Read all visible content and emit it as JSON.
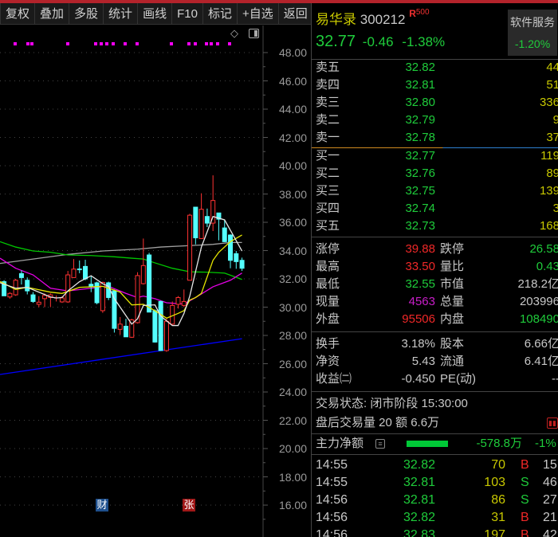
{
  "toolbar": {
    "buttons": [
      "复权",
      "叠加",
      "多股",
      "统计",
      "画线",
      "F10",
      "标记",
      "+自选",
      "返回"
    ]
  },
  "chart_data": {
    "type": "candlestick",
    "y_ticks": [
      "48.00",
      "46.00",
      "44.00",
      "42.00",
      "40.00",
      "38.00",
      "36.00",
      "34.00",
      "32.00",
      "30.00",
      "28.00",
      "26.00",
      "24.00",
      "22.00",
      "20.00",
      "18.00",
      "16.00"
    ],
    "ylim": [
      16,
      48
    ],
    "grid": true,
    "colors": {
      "up": "#ff3232",
      "down": "#54ffff",
      "ma5": "#e6e6e6",
      "ma10": "#e6e600",
      "ma20": "#e600e6",
      "ma60": "#00c800",
      "ma_long": "#a0a0a0",
      "trend": "#0000ff",
      "event_dot": "#ff00ff"
    },
    "candles": [
      [
        31.8,
        30.8,
        31.9,
        30.8
      ],
      [
        30.72,
        30.97,
        31.06,
        30.6
      ],
      [
        30.87,
        31.9,
        32.0,
        30.8
      ],
      [
        32.37,
        32.09,
        32.6,
        31.6
      ],
      [
        31.9,
        31.15,
        32.1,
        30.9
      ],
      [
        30.87,
        30.4,
        31.06,
        30.3
      ],
      [
        30.2,
        30.35,
        30.78,
        30.0
      ],
      [
        30.6,
        30.83,
        30.97,
        30.0
      ],
      [
        30.68,
        30.87,
        30.97,
        30.0
      ],
      [
        30.65,
        30.65,
        30.83,
        30.4
      ],
      [
        30.37,
        30.65,
        30.78,
        30.3
      ],
      [
        30.37,
        32.28,
        32.56,
        30.3
      ],
      [
        32.09,
        32.69,
        33.4,
        32.09
      ],
      [
        32.7,
        32.65,
        33.3,
        32.4
      ],
      [
        32.88,
        32.0,
        33.35,
        31.9
      ],
      [
        31.62,
        31.47,
        32.2,
        31.06
      ],
      [
        31.72,
        30.31,
        31.8,
        30.2
      ],
      [
        29.75,
        31.75,
        31.8,
        29.6
      ],
      [
        31.72,
        30.68,
        31.8,
        30.5
      ],
      [
        31.15,
        28.5,
        31.25,
        28.2
      ],
      [
        28.43,
        28.8,
        29.3,
        28.05
      ],
      [
        28.65,
        27.9,
        29.18,
        27.9
      ],
      [
        27.87,
        29.1,
        29.18,
        27.83
      ],
      [
        28.9,
        32.23,
        32.47,
        28.84
      ],
      [
        31.66,
        32.94,
        34.85,
        31.6
      ],
      [
        33.69,
        29.65,
        33.84,
        29.65
      ],
      [
        29.75,
        27.53,
        29.84,
        27.5
      ],
      [
        30.4,
        26.93,
        30.46,
        26.9
      ],
      [
        26.93,
        29.0,
        29.18,
        26.84
      ],
      [
        28.8,
        30.12,
        30.4,
        28.7
      ],
      [
        30.2,
        30.68,
        30.78,
        29.9
      ],
      [
        30.12,
        30.4,
        31.25,
        30.0
      ],
      [
        31.9,
        36.5,
        36.6,
        31.9
      ],
      [
        37.07,
        34.9,
        37.07,
        34.44
      ],
      [
        34.85,
        36.92,
        38.05,
        34.82
      ],
      [
        36.41,
        35.94,
        36.97,
        35.66
      ],
      [
        35.94,
        37.54,
        39.32,
        35.38
      ],
      [
        36.66,
        36.22,
        36.66,
        34.72
      ],
      [
        35.6,
        34.63,
        36.17,
        34.6
      ],
      [
        35.1,
        33.31,
        35.15,
        32.75
      ],
      [
        33.78,
        33.22,
        33.97,
        32.71
      ],
      [
        33.31,
        32.75,
        33.5,
        32.56
      ]
    ],
    "lines": {
      "ma5": [
        [
          -0.7,
          31.72
        ],
        [
          2,
          31.34
        ],
        [
          4,
          31.4
        ],
        [
          8,
          30.72
        ],
        [
          9,
          30.65
        ],
        [
          10,
          30.68
        ],
        [
          11,
          31.15
        ],
        [
          13,
          31.8
        ],
        [
          15,
          32.22
        ],
        [
          17,
          31.66
        ],
        [
          18,
          31.47
        ],
        [
          19,
          30.6
        ],
        [
          22,
          28.8
        ],
        [
          23,
          29.18
        ],
        [
          24,
          30.12
        ],
        [
          26,
          30.16
        ],
        [
          27,
          29.37
        ],
        [
          29,
          28.7
        ],
        [
          30,
          28.7
        ],
        [
          31,
          29.55
        ],
        [
          32,
          30.78
        ],
        [
          34,
          34.25
        ],
        [
          36,
          36.41
        ],
        [
          38,
          36.17
        ],
        [
          41,
          33.97
        ]
      ],
      "ma10": [
        [
          -0.7,
          31.81
        ],
        [
          2,
          31.25
        ],
        [
          4,
          31.4
        ],
        [
          8,
          31.06
        ],
        [
          10,
          30.97
        ],
        [
          13,
          31.4
        ],
        [
          17,
          31.47
        ],
        [
          18,
          31.34
        ],
        [
          20,
          31.06
        ],
        [
          22,
          30.16
        ],
        [
          24,
          30.2
        ],
        [
          26,
          29.75
        ],
        [
          28,
          29.22
        ],
        [
          30,
          29.56
        ],
        [
          31,
          29.75
        ],
        [
          32,
          30.5
        ],
        [
          33,
          30.68
        ],
        [
          34,
          30.97
        ],
        [
          36,
          33.31
        ],
        [
          37,
          33.88
        ],
        [
          39,
          34.63
        ],
        [
          41,
          35.1
        ]
      ],
      "ma20": [
        [
          -0.7,
          33.46
        ],
        [
          2,
          32.75
        ],
        [
          5,
          32.28
        ],
        [
          8,
          31.34
        ],
        [
          11,
          31.15
        ],
        [
          15,
          31.34
        ],
        [
          18,
          31.47
        ],
        [
          21,
          30.97
        ],
        [
          23,
          30.68
        ],
        [
          24,
          30.78
        ],
        [
          26,
          30.6
        ],
        [
          28,
          30.31
        ],
        [
          31,
          30.22
        ],
        [
          33,
          30.68
        ],
        [
          36,
          31.44
        ],
        [
          39,
          31.9
        ],
        [
          41,
          32.41
        ]
      ],
      "ma60": [
        [
          -0.7,
          34.63
        ],
        [
          2,
          34.25
        ],
        [
          5,
          33.97
        ],
        [
          8,
          33.88
        ],
        [
          11,
          33.69
        ],
        [
          15,
          33.65
        ],
        [
          19,
          33.56
        ],
        [
          22,
          33.46
        ],
        [
          24,
          33.4
        ],
        [
          26,
          33.13
        ],
        [
          29,
          32.75
        ],
        [
          32,
          32.5
        ],
        [
          35,
          32.47
        ],
        [
          38,
          32.41
        ],
        [
          41,
          31.96
        ]
      ],
      "ma_long": [
        [
          -0.7,
          33.09
        ],
        [
          5,
          33.4
        ],
        [
          11,
          33.73
        ],
        [
          17,
          33.97
        ],
        [
          23,
          34.1
        ],
        [
          27,
          34.25
        ],
        [
          32,
          34.35
        ],
        [
          36,
          34.44
        ],
        [
          39,
          34.57
        ],
        [
          41,
          34.57
        ]
      ],
      "trend": [
        [
          -0.7,
          25.24
        ],
        [
          41,
          27.77
        ]
      ]
    },
    "event_badges": [
      {
        "label": "财",
        "color": "#1e4f8c"
      },
      {
        "label": "张",
        "color": "#a01818"
      }
    ]
  },
  "quote": {
    "name": "易华录",
    "code": "300212",
    "tag": "R",
    "tag_num": "500",
    "price": "32.77",
    "change": "-0.46",
    "change_pct": "-1.38%",
    "sector": "软件服务",
    "sector_pct": "-1.20%"
  },
  "orderbook": {
    "sell": [
      {
        "label": "卖五",
        "price": "32.82",
        "vol": "44"
      },
      {
        "label": "卖四",
        "price": "32.81",
        "vol": "51"
      },
      {
        "label": "卖三",
        "price": "32.80",
        "vol": "336"
      },
      {
        "label": "卖二",
        "price": "32.79",
        "vol": "9"
      },
      {
        "label": "卖一",
        "price": "32.78",
        "vol": "37"
      }
    ],
    "buy": [
      {
        "label": "买一",
        "price": "32.77",
        "vol": "119"
      },
      {
        "label": "买二",
        "price": "32.76",
        "vol": "89"
      },
      {
        "label": "买三",
        "price": "32.75",
        "vol": "139"
      },
      {
        "label": "买四",
        "price": "32.74",
        "vol": "3"
      },
      {
        "label": "买五",
        "price": "32.73",
        "vol": "168"
      }
    ]
  },
  "stats": [
    {
      "l1": "涨停",
      "v1": "39.88",
      "c1": "rd",
      "l2": "跌停",
      "v2": "26.58",
      "c2": "g"
    },
    {
      "l1": "最高",
      "v1": "33.50",
      "c1": "rd",
      "l2": "量比",
      "v2": "0.43",
      "c2": "g"
    },
    {
      "l1": "最低",
      "v1": "32.55",
      "c1": "g",
      "l2": "市值",
      "v2": "218.2亿",
      "c2": "w"
    },
    {
      "l1": "现量",
      "v1": "4563",
      "c1": "p",
      "l2": "总量",
      "v2": "203996",
      "c2": "w"
    },
    {
      "l1": "外盘",
      "v1": "95506",
      "c1": "rd",
      "l2": "内盘",
      "v2": "108490",
      "c2": "g"
    }
  ],
  "stats2": [
    {
      "l1": "换手",
      "v1": "3.18%",
      "l2": "股本",
      "v2": "6.66亿"
    },
    {
      "l1": "净资",
      "v1": "5.43",
      "l2": "流通",
      "v2": "6.41亿"
    },
    {
      "l1": "收益㈡",
      "v1": "-0.450",
      "l2": "PE(动)",
      "v2": "--"
    }
  ],
  "status": {
    "trade_state": "交易状态: 闭市阶段 15:30:00",
    "after_hours": "盘后交易量 20 额 6.6万"
  },
  "main_flow": {
    "label": "主力净额",
    "amount": "-578.8万",
    "pct": "-1%",
    "level": 0.5
  },
  "ticks": [
    {
      "time": "14:55",
      "price": "32.82",
      "vol": "70",
      "side": "B",
      "count": "15"
    },
    {
      "time": "14:55",
      "price": "32.81",
      "vol": "103",
      "side": "S",
      "count": "46"
    },
    {
      "time": "14:56",
      "price": "32.81",
      "vol": "86",
      "side": "S",
      "count": "27"
    },
    {
      "time": "14:56",
      "price": "32.82",
      "vol": "31",
      "side": "B",
      "count": "21"
    },
    {
      "time": "14:56",
      "price": "32.83",
      "vol": "197",
      "side": "B",
      "count": "42"
    }
  ]
}
